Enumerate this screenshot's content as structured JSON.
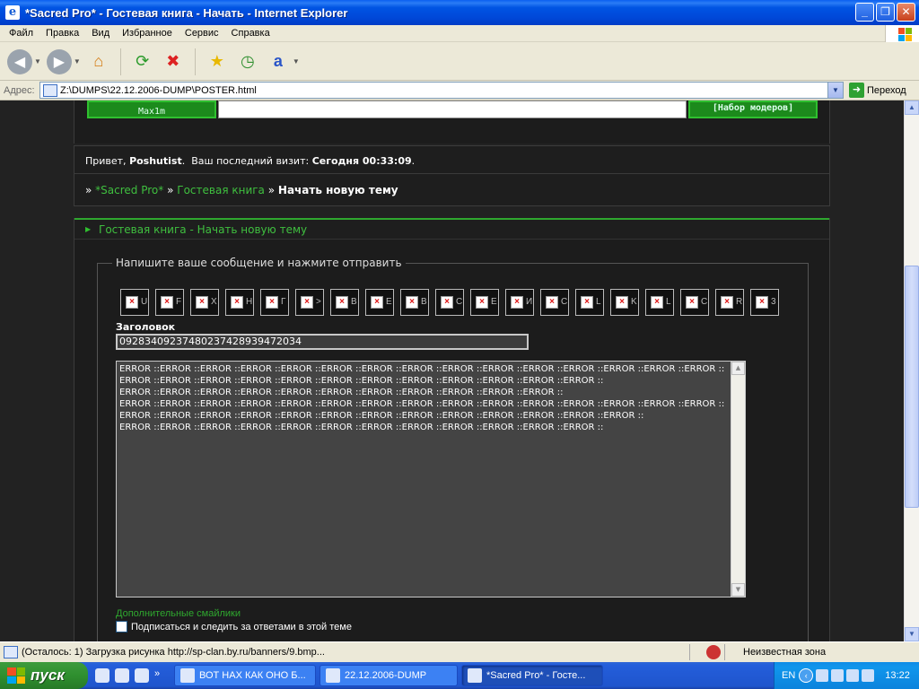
{
  "window": {
    "title": "*Sacred Pro* - Гостевая книга - Начать - Internet Explorer",
    "minimize": "_",
    "maximize": "❐",
    "close": "✕"
  },
  "menu": [
    "Файл",
    "Правка",
    "Вид",
    "Избранное",
    "Сервис",
    "Справка"
  ],
  "toolbar": {
    "icons": [
      "back-icon",
      "forward-icon",
      "home-icon",
      "refresh-icon",
      "stop-icon",
      "favorites-icon",
      "history-icon",
      "encoding-icon"
    ]
  },
  "address": {
    "label": "Адрес:",
    "value": "Z:\\DUMPS\\22.12.2006-DUMP\\POSTER.html",
    "go_label": "Переход"
  },
  "banner": {
    "left_cell": "Max1m",
    "right_cell": "[Набор модеров]"
  },
  "welcome": {
    "greeting": "Привет,",
    "username": "Poshutist",
    "last_visit_label": "Ваш последний визит:",
    "last_visit_value": "Сегодня 00:33:09",
    "crumb_sep": "»",
    "crumb_site": "*Sacred Pro*",
    "crumb_book": "Гостевая книга",
    "crumb_current": "Начать новую тему"
  },
  "section": {
    "title": "Гостевая книга - Начать новую тему"
  },
  "form": {
    "legend": "Напишите ваше сообщение и нажмите отправить",
    "bbcode_buttons": [
      "U",
      "F",
      "X",
      "H",
      "Г",
      ">",
      "B",
      "E",
      "B",
      "C",
      "E",
      "И",
      "C",
      "L",
      "K",
      "L",
      "C",
      "R",
      "3"
    ],
    "subject_label": "Заголовок",
    "subject_value": "09283409237480237428939472034",
    "message": "ERROR ::ERROR ::ERROR ::ERROR ::ERROR ::ERROR ::ERROR ::ERROR ::ERROR ::ERROR ::ERROR ::ERROR ::ERROR ::ERROR ::ERROR ::ERROR ::ERROR ::ERROR ::ERROR ::ERROR ::ERROR ::ERROR ::ERROR ::ERROR ::ERROR ::ERROR ::ERROR ::\nERROR ::ERROR ::ERROR ::ERROR ::ERROR ::ERROR ::ERROR ::ERROR ::ERROR ::ERROR ::ERROR ::\nERROR ::ERROR ::ERROR ::ERROR ::ERROR ::ERROR ::ERROR ::ERROR ::ERROR ::ERROR ::ERROR ::ERROR ::ERROR ::ERROR ::ERROR ::\nERROR ::ERROR ::ERROR ::ERROR ::ERROR ::ERROR ::ERROR ::ERROR ::ERROR ::ERROR ::ERROR ::ERROR ::ERROR ::\nERROR ::ERROR ::ERROR ::ERROR ::ERROR ::ERROR ::ERROR ::ERROR ::ERROR ::ERROR ::ERROR ::ERROR ::",
    "more_smiles": "Дополнительные смайлики",
    "subscribe_label": "Подписаться и следить за ответами в этой теме"
  },
  "status": {
    "text": "(Осталось: 1) Загрузка рисунка http://sp-clan.by.ru/banners/9.bmp...",
    "zone": "Неизвестная зона"
  },
  "taskbar": {
    "start_label": "пуск",
    "tasks": [
      "ВОТ НАХ КАК ОНО Б...",
      "22.12.2006-DUMP",
      "*Sacred Pro* - Госте..."
    ],
    "lang": "EN",
    "clock": "13:22"
  }
}
